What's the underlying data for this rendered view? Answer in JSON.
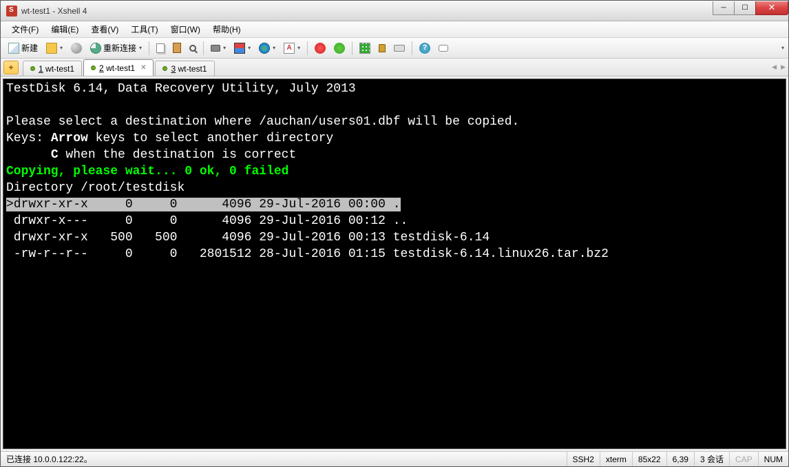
{
  "window": {
    "title": "wt-test1 - Xshell 4"
  },
  "menu": {
    "file": "文件(F)",
    "edit": "编辑(E)",
    "view": "查看(V)",
    "tools": "工具(T)",
    "window": "窗口(W)",
    "help": "帮助(H)"
  },
  "toolbar": {
    "new": "新建",
    "reconnect": "重新连接"
  },
  "tabs": {
    "plus": "+",
    "t1": {
      "num": "1",
      "name": " wt-test1"
    },
    "t2": {
      "num": "2",
      "name": " wt-test1"
    },
    "t3": {
      "num": "3",
      "name": " wt-test1"
    }
  },
  "term": {
    "l1": "TestDisk 6.14, Data Recovery Utility, July 2013",
    "l2": "",
    "l3": "Please select a destination where /auchan/users01.dbf will be copied.",
    "l4a": "Keys: ",
    "l4b": "Arrow",
    "l4c": " keys to select another directory",
    "l5a": "      ",
    "l5b": "C",
    "l5c": " when the destination is correct",
    "l6": "Copying, please wait... 0 ok, 0 failed",
    "l7": "Directory /root/testdisk",
    "row1": ">drwxr-xr-x     0     0      4096 29-Jul-2016 00:00 .",
    "row2": " drwxr-x---     0     0      4096 29-Jul-2016 00:12 ..",
    "row3": " drwxr-xr-x   500   500      4096 29-Jul-2016 00:13 testdisk-6.14",
    "row4": " -rw-r--r--     0     0   2801512 28-Jul-2016 01:15 testdisk-6.14.linux26.tar.bz2"
  },
  "status": {
    "conn": "已连接 10.0.0.122:22。",
    "proto": "SSH2",
    "term": "xterm",
    "size": "85x22",
    "pos": "6,39",
    "sess": "3 会话",
    "cap": "CAP",
    "num": "NUM"
  }
}
